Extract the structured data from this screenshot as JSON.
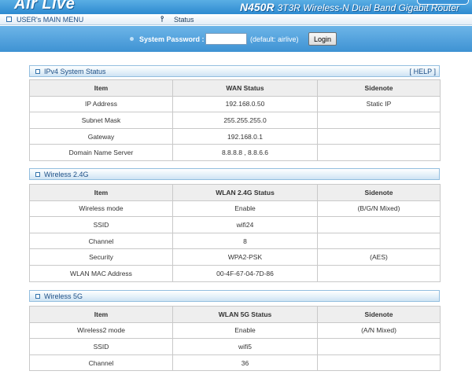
{
  "header": {
    "logo_text": "Air Live",
    "model": "N450R",
    "description": "3T3R Wireless-N Dual Band Gigabit Router",
    "brand_color": "#2d8ad0"
  },
  "menu": {
    "main_menu_label": "USER's MAIN MENU",
    "status_icon": "signal-icon",
    "status_label": "Status"
  },
  "login": {
    "password_label": "System Password :",
    "password_value": "",
    "default_hint": "(default: airlive)",
    "login_button": "Login"
  },
  "sections": {
    "ipv4": {
      "title": "IPv4 System Status",
      "help": "[ HELP ]",
      "headers": [
        "Item",
        "WAN Status",
        "Sidenote"
      ],
      "rows": [
        [
          "IP Address",
          "192.168.0.50",
          "Static IP"
        ],
        [
          "Subnet Mask",
          "255.255.255.0",
          ""
        ],
        [
          "Gateway",
          "192.168.0.1",
          ""
        ],
        [
          "Domain Name Server",
          "8.8.8.8 , 8.8.6.6",
          ""
        ]
      ]
    },
    "wireless24": {
      "title": "Wireless 2.4G",
      "headers": [
        "Item",
        "WLAN 2.4G Status",
        "Sidenote"
      ],
      "rows": [
        [
          "Wireless mode",
          "Enable",
          "(B/G/N Mixed)"
        ],
        [
          "SSID",
          "wifi24",
          ""
        ],
        [
          "Channel",
          "8",
          ""
        ],
        [
          "Security",
          "WPA2-PSK",
          "(AES)"
        ],
        [
          "WLAN MAC Address",
          "00-4F-67-04-7D-86",
          ""
        ]
      ]
    },
    "wireless5": {
      "title": "Wireless 5G",
      "headers": [
        "Item",
        "WLAN 5G Status",
        "Sidenote"
      ],
      "rows": [
        [
          "Wireless2 mode",
          "Enable",
          "(A/N Mixed)"
        ],
        [
          "SSID",
          "wifi5",
          ""
        ],
        [
          "Channel",
          "36",
          ""
        ]
      ]
    }
  }
}
